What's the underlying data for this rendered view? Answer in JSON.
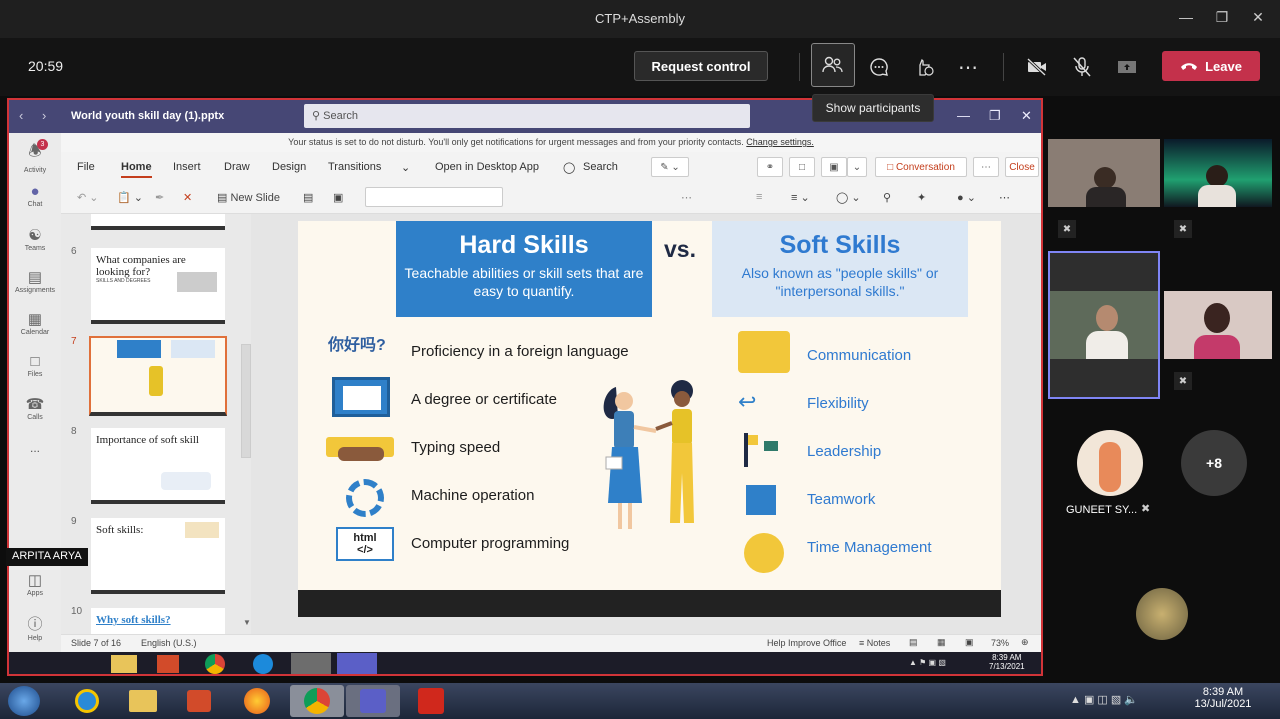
{
  "window": {
    "title": "CTP+Assembly"
  },
  "meeting": {
    "clock": "20:59",
    "request_control": "Request control",
    "leave": "Leave",
    "tooltip": "Show participants"
  },
  "shared_window": {
    "filename": "World youth skill day (1).pptx",
    "search_placeholder": "Search"
  },
  "teams_rail": [
    {
      "label": "Activity",
      "badge": "3"
    },
    {
      "label": "Chat"
    },
    {
      "label": "Teams"
    },
    {
      "label": "Assignments"
    },
    {
      "label": "Calendar"
    },
    {
      "label": "Files"
    },
    {
      "label": "Calls"
    },
    {
      "label": "..."
    },
    {
      "label": "Apps"
    },
    {
      "label": "Help"
    }
  ],
  "notification": {
    "text": "Your status is set to do not disturb. You'll only get notifications for urgent messages and from your priority contacts.",
    "link": "Change settings."
  },
  "ribbon": {
    "tabs": [
      "File",
      "Home",
      "Insert",
      "Draw",
      "Design",
      "Transitions"
    ],
    "open_desktop": "Open in Desktop App",
    "search": "Search",
    "conversation": "Conversation",
    "close": "Close",
    "new_slide": "New Slide"
  },
  "thumbnails": [
    {
      "num": "6",
      "title": "What companies are looking for?",
      "sub": "SKILLS AND DEGREES"
    },
    {
      "num": "7",
      "title": "",
      "sub": ""
    },
    {
      "num": "8",
      "title": "Importance of soft skill",
      "sub": ""
    },
    {
      "num": "9",
      "title": "Soft skills:",
      "sub": ""
    },
    {
      "num": "10",
      "title": "Why soft skills?",
      "sub": ""
    }
  ],
  "slide": {
    "hard_title": "Hard Skills",
    "hard_sub": "Teachable abilities or skill sets that are easy to quantify.",
    "vs": "vs.",
    "soft_title": "Soft Skills",
    "soft_sub": "Also known as \"people skills\" or \"interpersonal skills.\"",
    "hard_items": [
      "Proficiency in a foreign language",
      "A degree or certificate",
      "Typing speed",
      "Machine operation",
      "Computer programming"
    ],
    "soft_items": [
      "Communication",
      "Flexibility",
      "Leadership",
      "Teamwork",
      "Time Management"
    ],
    "lang_icon_text": "你好吗?",
    "html_icon_text": "html"
  },
  "statusbar": {
    "slide_count": "Slide 7 of 16",
    "language": "English (U.S.)",
    "help": "Help Improve Office",
    "notes": "Notes",
    "zoom": "73%"
  },
  "inner_taskbar": {
    "time": "8:39 AM",
    "date": "7/13/2021"
  },
  "presenter": "ARPITA ARYA",
  "participants": {
    "named": "GUNEET SY...",
    "more": "+8"
  },
  "windows_taskbar": {
    "time": "8:39 AM",
    "date": "13/Jul/2021"
  },
  "colors": {
    "leave": "#c4314b",
    "teams": "#464775",
    "hard": "#2f80c9",
    "soft_text": "#2f7ad0"
  }
}
